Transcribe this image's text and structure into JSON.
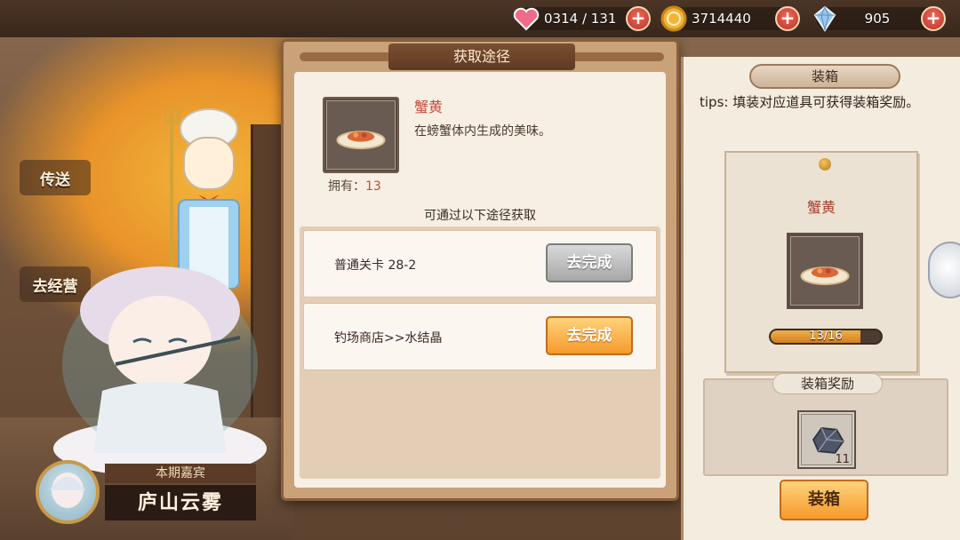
{
  "status_bar": {
    "stamina": {
      "value": "0314 / 131",
      "icon": "heart-icon"
    },
    "gold": {
      "value": "3714440",
      "icon": "coin-icon"
    },
    "gems": {
      "value": "905",
      "icon": "crystal-icon"
    },
    "plus_label": "+"
  },
  "background": {
    "nav_teleport": "传送",
    "nav_back": "去经营",
    "guest": {
      "tag": "本期嘉宾",
      "name": "庐山云雾"
    }
  },
  "dialog": {
    "title": "获取途径",
    "item": {
      "name": "蟹黄",
      "description": "在螃蟹体内生成的美味。",
      "owned_label": "拥有：",
      "owned_count": "13"
    },
    "ways_header": "可通过以下途径获取",
    "ways": [
      {
        "label": "普通关卡 28-2",
        "button": "去完成",
        "state": "disabled"
      },
      {
        "label": "钓场商店>>水结晶",
        "button": "去完成",
        "state": "active"
      }
    ]
  },
  "box_panel": {
    "title": "装箱",
    "tips": "tips: 填装对应道具可获得装箱奖励。",
    "card": {
      "item_name": "蟹黄",
      "progress_text": "13/16",
      "progress_fraction": 0.8125
    },
    "reward_title": "装箱奖励",
    "reward_count": "11",
    "action_button": "装箱"
  },
  "colors": {
    "accent_orange": "#f59a2c",
    "title_brown": "#5e3a23",
    "item_red": "#c44b3c"
  }
}
